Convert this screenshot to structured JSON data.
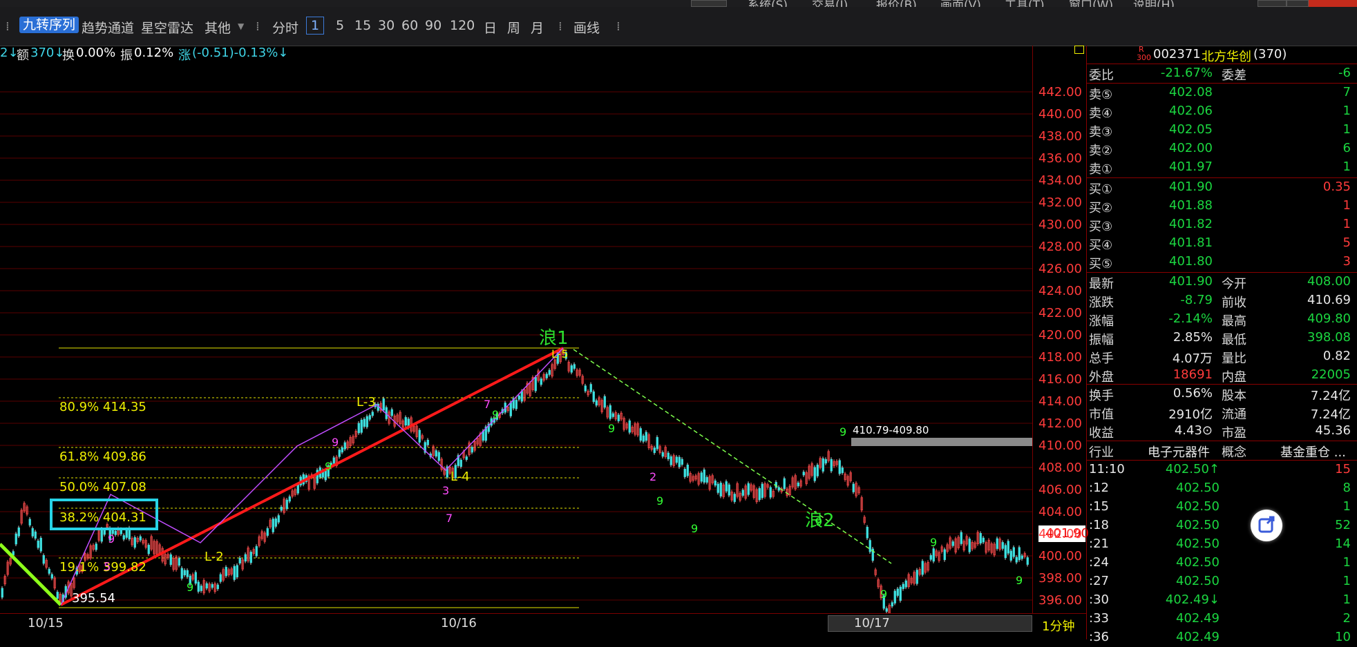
{
  "menu": [
    "系统(S)",
    "交易(J)",
    "报价(B)",
    "画面(V)",
    "工具(T)",
    "窗口(W)",
    "说明(H)"
  ],
  "toolbar": {
    "items": [
      "九转序列",
      "趋势通道",
      "星空雷达",
      "其他",
      "分时",
      "1",
      "5",
      "15",
      "30",
      "60",
      "90",
      "120",
      "日",
      "周",
      "月",
      "画线"
    ]
  },
  "infobar": {
    "prefix": "2↓",
    "amount_label": "额",
    "amount": "370↓",
    "turnover_label": "换",
    "turnover": "0.00%",
    "amplitude_label": "振",
    "amplitude": "0.12%",
    "change_label": "涨",
    "change": "(-0.51)-0.13%↓"
  },
  "chart": {
    "price_ticks": [
      "442.00",
      "440.00",
      "438.00",
      "436.00",
      "434.00",
      "432.00",
      "430.00",
      "428.00",
      "426.00",
      "424.00",
      "422.00",
      "420.00",
      "418.00",
      "416.00",
      "414.00",
      "412.00",
      "410.00",
      "408.00",
      "406.00",
      "404.00",
      "402.00",
      "400.00",
      "398.00",
      "396.00"
    ],
    "dates": [
      "10/15",
      "10/16",
      "10/17"
    ],
    "period": "1分钟",
    "current_price": "401.90",
    "fib": [
      {
        "label": "80.9% 414.35"
      },
      {
        "label": "61.8% 409.86"
      },
      {
        "label": "50.0% 407.08"
      },
      {
        "label": "38.2% 404.31"
      },
      {
        "label": "19.1% 399.82"
      }
    ],
    "low_label": "395.54",
    "wave1": "浪1",
    "wave2": "浪2",
    "l_labels": [
      "L-2",
      "L-3",
      "L-4",
      "L-5"
    ],
    "range_label": "410.79-409.80"
  },
  "panel": {
    "mark_top": "R",
    "mark_bottom": "300",
    "code": "002371",
    "name": "北方华创",
    "count": "(370)",
    "weibi_label": "委比",
    "weibi": "-21.67%",
    "weicha_label": "委差",
    "weicha": "-6",
    "sell": [
      {
        "label": "卖⑤",
        "price": "402.08",
        "vol": "7"
      },
      {
        "label": "卖④",
        "price": "402.06",
        "vol": "1"
      },
      {
        "label": "卖③",
        "price": "402.05",
        "vol": "1"
      },
      {
        "label": "卖②",
        "price": "402.00",
        "vol": "6"
      },
      {
        "label": "卖①",
        "price": "401.97",
        "vol": "1"
      }
    ],
    "buy": [
      {
        "label": "买①",
        "price": "401.90",
        "vol": "0.35"
      },
      {
        "label": "买②",
        "price": "401.88",
        "vol": "1"
      },
      {
        "label": "买③",
        "price": "401.82",
        "vol": "1"
      },
      {
        "label": "买④",
        "price": "401.81",
        "vol": "5"
      },
      {
        "label": "买⑤",
        "price": "401.80",
        "vol": "3"
      }
    ],
    "stats": [
      {
        "l1": "最新",
        "v1": "401.90",
        "c1": "green",
        "l2": "今开",
        "v2": "408.00",
        "c2": "green"
      },
      {
        "l1": "涨跌",
        "v1": "-8.79",
        "c1": "green",
        "l2": "前收",
        "v2": "410.69",
        "c2": "white"
      },
      {
        "l1": "涨幅",
        "v1": "-2.14%",
        "c1": "green",
        "l2": "最高",
        "v2": "409.80",
        "c2": "green"
      },
      {
        "l1": "振幅",
        "v1": "2.85%",
        "c1": "white",
        "l2": "最低",
        "v2": "398.08",
        "c2": "green"
      },
      {
        "l1": "总手",
        "v1": "4.07万",
        "c1": "white",
        "l2": "量比",
        "v2": "0.82",
        "c2": "white"
      },
      {
        "l1": "外盘",
        "v1": "18691",
        "c1": "red",
        "l2": "内盘",
        "v2": "22005",
        "c2": "green"
      }
    ],
    "stats2": [
      {
        "l1": "换手",
        "v1": "0.56%",
        "l2": "股本",
        "v2": "7.24亿"
      },
      {
        "l1": "市值",
        "v1": "2910亿",
        "l2": "流通",
        "v2": "7.24亿"
      },
      {
        "l1": "收益",
        "v1": "4.43⊙",
        "l2": "市盈",
        "v2": "45.36"
      }
    ],
    "industry_label": "行业",
    "industry": "电子元器件",
    "concept_label": "概念",
    "concept": "基金重仓 ...",
    "ticks": [
      {
        "t": "11:10",
        "p": "402.50↑",
        "v": "15",
        "vc": "red"
      },
      {
        "t": ":12",
        "p": "402.50",
        "v": "8",
        "vc": "green"
      },
      {
        "t": ":15",
        "p": "402.50",
        "v": "1",
        "vc": "green"
      },
      {
        "t": ":18",
        "p": "402.50",
        "v": "52",
        "vc": "green"
      },
      {
        "t": ":21",
        "p": "402.50",
        "v": "14",
        "vc": "green"
      },
      {
        "t": ":24",
        "p": "402.50",
        "v": "1",
        "vc": "green"
      },
      {
        "t": ":27",
        "p": "402.50",
        "v": "1",
        "vc": "green"
      },
      {
        "t": ":30",
        "p": "402.49↓",
        "v": "1",
        "vc": "green"
      },
      {
        "t": ":33",
        "p": "402.49",
        "v": "2",
        "vc": "green"
      },
      {
        "t": ":36",
        "p": "402.49",
        "v": "10",
        "vc": "green"
      }
    ]
  }
}
